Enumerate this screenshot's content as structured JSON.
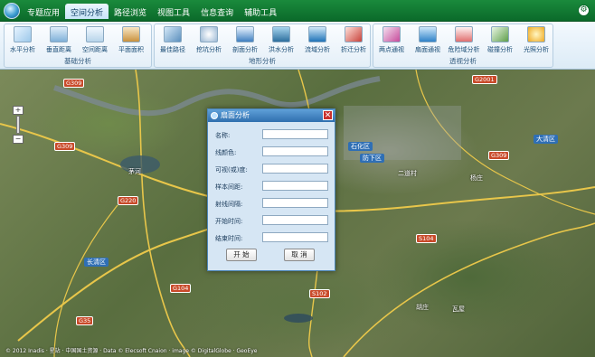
{
  "menu": {
    "items": [
      "专题应用",
      "空间分析",
      "路径浏览",
      "视图工具",
      "信息查询",
      "辅助工具"
    ],
    "active_index": 1
  },
  "ribbon": {
    "groups": [
      {
        "label": "基础分析",
        "tools": [
          "水平分析",
          "垂直距离",
          "空间距离",
          "平面面积"
        ]
      },
      {
        "label": "地形分析",
        "tools": [
          "最佳路径",
          "挖坑分析",
          "剖面分析",
          "洪水分析",
          "流域分析",
          "折迁分析"
        ]
      },
      {
        "label": "透视分析",
        "tools": [
          "两点通视",
          "扇面通视",
          "危险域分析",
          "碰撞分析",
          "光照分析"
        ]
      }
    ]
  },
  "map": {
    "places": [
      "石化区",
      "防下区",
      "二道村",
      "大清区",
      "长清区",
      "茅河",
      "杨庄",
      "瓦屋",
      "胡庄"
    ],
    "roads": [
      "G309",
      "G220",
      "G309",
      "G104",
      "G35",
      "G2001",
      "S102",
      "S104",
      "G309"
    ],
    "attribution": "© 2012 Inadis · 星站 · 中国国土资源 · Data © Elecsoft Cnaion · image © DigitalGlobe · GeoEye"
  },
  "dialog": {
    "title": "扇面分析",
    "close_label": "✕",
    "fields": [
      {
        "label": "名称:",
        "value": ""
      },
      {
        "label": "线颜色:",
        "value": ""
      },
      {
        "label": "可视(或)度:",
        "value": ""
      },
      {
        "label": "样本间距:",
        "value": ""
      },
      {
        "label": "射线间隔:",
        "value": ""
      },
      {
        "label": "开始时间:",
        "value": ""
      },
      {
        "label": "结束时间:",
        "value": ""
      }
    ],
    "start_label": "开 始",
    "cancel_label": "取 消"
  },
  "zoom": {
    "in_label": "+",
    "out_label": "−"
  },
  "colors": {
    "topbar": "#0b6a2a",
    "ribbon": "#dcebf6",
    "dialog_title": "#2f6fae",
    "close": "#c9302c"
  }
}
